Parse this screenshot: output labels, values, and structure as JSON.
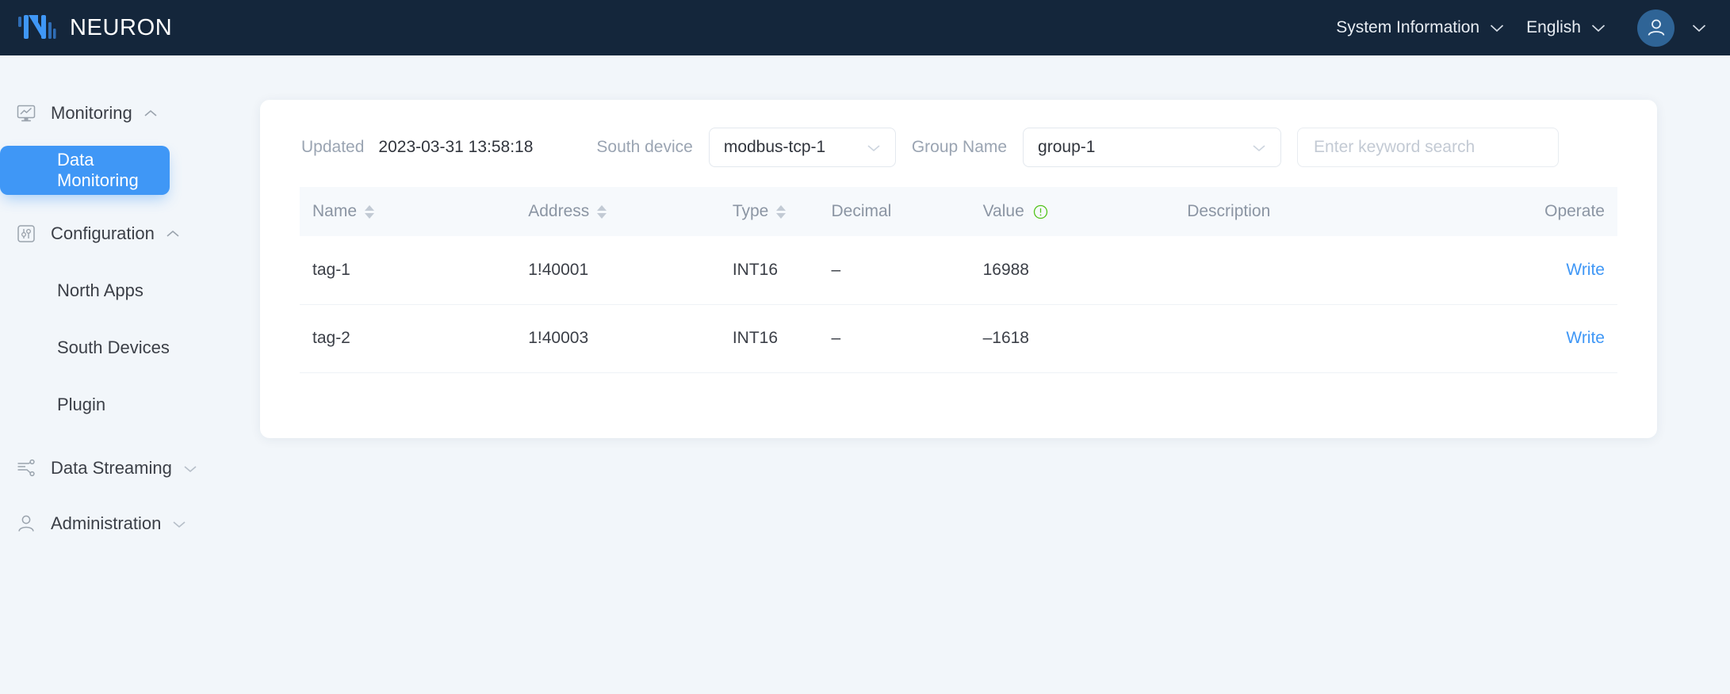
{
  "header": {
    "brand": "NEURON",
    "logo_color": "#3f97f6",
    "bar_color": "#14263b",
    "menus": [
      {
        "label": "System Information",
        "icon": "chevron-down-icon"
      },
      {
        "label": "English",
        "icon": "chevron-down-icon"
      }
    ],
    "avatar_icon": "user-avatar-icon",
    "avatar_chevron": "chevron-down-icon"
  },
  "sidebar": {
    "groups": [
      {
        "label": "Monitoring",
        "icon": "monitor-chart-icon",
        "arrow": "chevron-up-icon",
        "expanded": true,
        "children": [
          {
            "label": "Data Monitoring",
            "active": true
          }
        ]
      },
      {
        "label": "Configuration",
        "icon": "sliders-icon",
        "arrow": "chevron-up-icon",
        "expanded": true,
        "children": [
          {
            "label": "North Apps",
            "active": false
          },
          {
            "label": "South Devices",
            "active": false
          },
          {
            "label": "Plugin",
            "active": false
          }
        ]
      },
      {
        "label": "Data Streaming",
        "icon": "data-flow-icon",
        "arrow": "chevron-down-icon",
        "expanded": false,
        "children": []
      },
      {
        "label": "Administration",
        "icon": "person-icon",
        "arrow": "chevron-down-icon",
        "expanded": false,
        "children": []
      }
    ],
    "active_color": "#3f97f6"
  },
  "filters": {
    "updated_label": "Updated",
    "updated_value": "2023-03-31 13:58:18",
    "south_device_label": "South device",
    "south_device_value": "modbus-tcp-1",
    "group_name_label": "Group Name",
    "group_name_value": "group-1",
    "search_placeholder": "Enter keyword search",
    "search_value": ""
  },
  "table": {
    "columns": [
      {
        "key": "name",
        "label": "Name",
        "sortable": true
      },
      {
        "key": "address",
        "label": "Address",
        "sortable": true
      },
      {
        "key": "type",
        "label": "Type",
        "sortable": true
      },
      {
        "key": "decimal",
        "label": "Decimal",
        "sortable": false
      },
      {
        "key": "value",
        "label": "Value",
        "sortable": false,
        "info_icon": "info-circle-icon",
        "info_color": "#52c41a"
      },
      {
        "key": "desc",
        "label": "Description",
        "sortable": false
      },
      {
        "key": "operate",
        "label": "Operate",
        "sortable": false
      }
    ],
    "rows": [
      {
        "name": "tag-1",
        "address": "1!40001",
        "type": "INT16",
        "decimal": "–",
        "value": "16988",
        "desc": "",
        "operate": "Write"
      },
      {
        "name": "tag-2",
        "address": "1!40003",
        "type": "INT16",
        "decimal": "–",
        "value": "–1618",
        "desc": "",
        "operate": "Write"
      }
    ],
    "link_color": "#3f97f6"
  }
}
